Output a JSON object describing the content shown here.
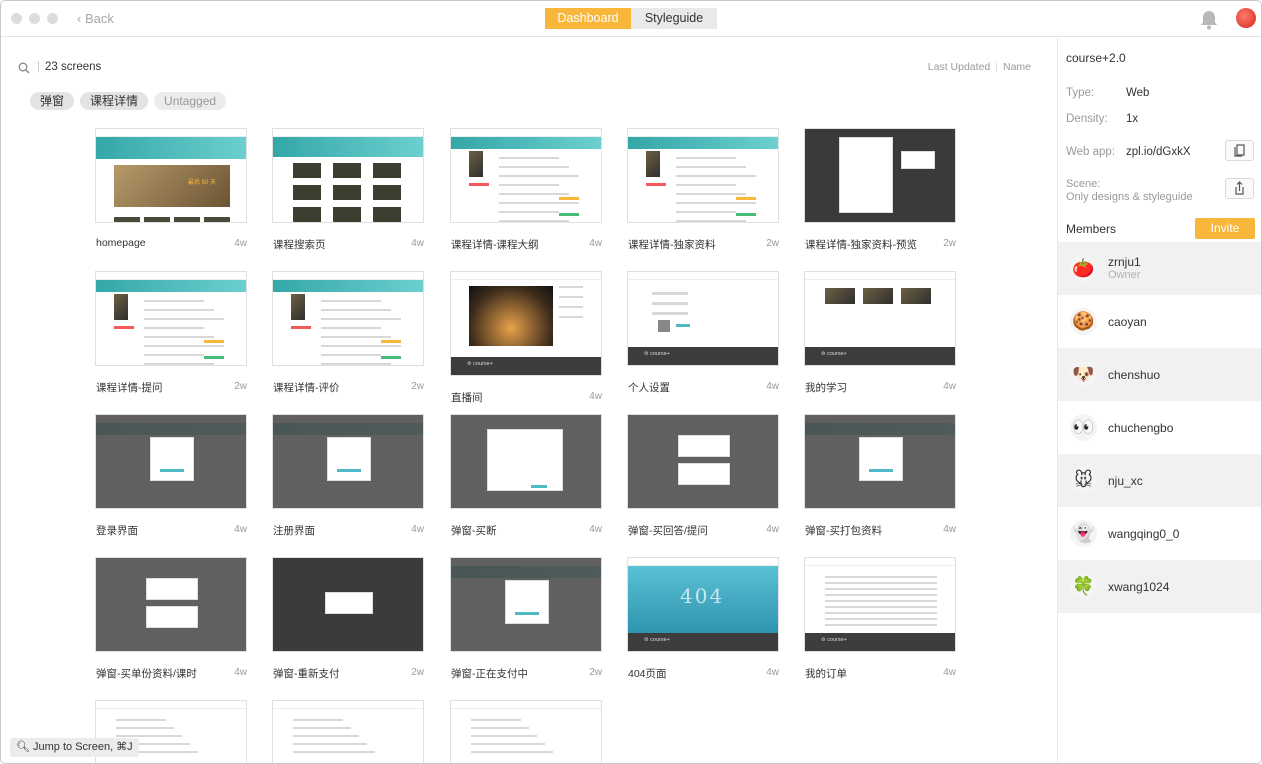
{
  "titlebar": {
    "back_label": "Back",
    "tabs": [
      {
        "label": "Dashboard",
        "active": true
      },
      {
        "label": "Styleguide",
        "active": false
      }
    ]
  },
  "toolbar": {
    "screen_count": "23 screens",
    "sort_options": [
      "Last Updated",
      "Name"
    ]
  },
  "tags": [
    "弹窗",
    "课程详情",
    "Untagged"
  ],
  "screens": [
    {
      "name": "homepage",
      "age": "4w",
      "style": "home"
    },
    {
      "name": "课程搜索页",
      "age": "4w",
      "style": "search"
    },
    {
      "name": "课程详情-课程大纲",
      "age": "4w",
      "style": "detail"
    },
    {
      "name": "课程详情-独家资料",
      "age": "2w",
      "style": "detail"
    },
    {
      "name": "课程详情-独家资料-预览",
      "age": "2w",
      "style": "dark-preview"
    },
    {
      "name": "课程详情-提问",
      "age": "2w",
      "style": "detail"
    },
    {
      "name": "课程详情-评价",
      "age": "2w",
      "style": "detail"
    },
    {
      "name": "直播间",
      "age": "4w",
      "style": "live"
    },
    {
      "name": "个人设置",
      "age": "4w",
      "style": "settings"
    },
    {
      "name": "我的学习",
      "age": "4w",
      "style": "study"
    },
    {
      "name": "登录界面",
      "age": "4w",
      "style": "modal"
    },
    {
      "name": "注册界面",
      "age": "4w",
      "style": "modal"
    },
    {
      "name": "弹窗-买断",
      "age": "4w",
      "style": "modal-wide"
    },
    {
      "name": "弹窗-买回答/提问",
      "age": "4w",
      "style": "modal-double"
    },
    {
      "name": "弹窗-买打包资料",
      "age": "4w",
      "style": "modal"
    },
    {
      "name": "弹窗-买单份资料/课时",
      "age": "4w",
      "style": "modal-double"
    },
    {
      "name": "弹窗-重新支付",
      "age": "2w",
      "style": "modal-dark"
    },
    {
      "name": "弹窗-正在支付中",
      "age": "2w",
      "style": "modal"
    },
    {
      "name": "404页面",
      "age": "4w",
      "style": "404"
    },
    {
      "name": "我的订单",
      "age": "4w",
      "style": "orders"
    },
    {
      "name": "",
      "age": "",
      "style": "plain"
    },
    {
      "name": "",
      "age": "",
      "style": "plain"
    },
    {
      "name": "",
      "age": "",
      "style": "plain"
    }
  ],
  "thumb_text": {
    "home_banner": "最后 50 天",
    "page_404": "404",
    "footer_logo": "course+"
  },
  "jump": {
    "label": "Jump to Screen, ⌘J"
  },
  "sidebar": {
    "project": "course+2.0",
    "type_label": "Type:",
    "type_value": "Web",
    "density_label": "Density:",
    "density_value": "1x",
    "webapp_label": "Web app:",
    "webapp_value": "zpl.io/dGxkX",
    "scene_label": "Scene:",
    "scene_value": "Only designs & styleguide",
    "members_title": "Members",
    "invite_label": "Invite",
    "members": [
      {
        "name": "zrnju1",
        "role": "Owner",
        "emoji": "🍅"
      },
      {
        "name": "caoyan",
        "role": "",
        "emoji": "🍪"
      },
      {
        "name": "chenshuo",
        "role": "",
        "emoji": "🐶"
      },
      {
        "name": "chuchengbo",
        "role": "",
        "emoji": "👀"
      },
      {
        "name": "nju_xc",
        "role": "",
        "emoji": "🐭"
      },
      {
        "name": "wangqing0_0",
        "role": "",
        "emoji": "👻"
      },
      {
        "name": "xwang1024",
        "role": "",
        "emoji": "🍀"
      }
    ]
  },
  "colors": {
    "accent": "#f8b63a",
    "teal": "#4fb9c4"
  }
}
